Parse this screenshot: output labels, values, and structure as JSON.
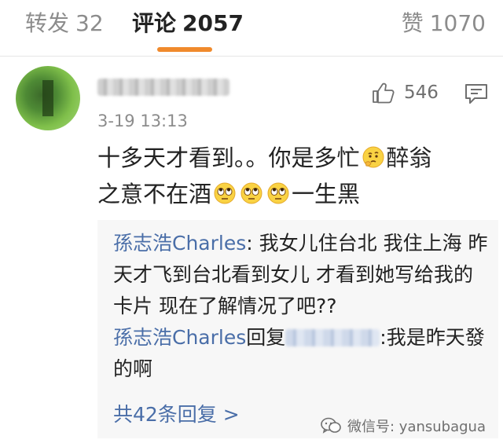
{
  "tabs": {
    "repost_label": "转发",
    "repost_count": "32",
    "comments_label": "评论",
    "comments_count": "2057",
    "likes_label": "赞",
    "likes_count": "1070",
    "active_color": "#f08a2c"
  },
  "comment": {
    "timestamp": "3-19 13:13",
    "like_count": "546",
    "text_line1_a": "十多天才看到。。你是多忙",
    "text_line1_b": "醉翁",
    "text_line2_a": "之意不在酒",
    "text_line2_b": "一生黑"
  },
  "replies": [
    {
      "author": "孫志浩Charles",
      "sep": ": ",
      "text": "我女儿住台北 我住上海 昨天才飞到台北看到女儿 才看到她写给我的卡片 现在了解情况了吧??"
    },
    {
      "author": "孫志浩Charles",
      "reply_word": "回复",
      "sep": ":",
      "text": "我是昨天發的啊"
    }
  ],
  "more_replies": "共42条回复 >",
  "watermark": "微信号: yansubagua",
  "colors": {
    "link": "#4a6ea8",
    "muted": "#8c8c8c",
    "reply_bg": "#f7f7f7"
  }
}
